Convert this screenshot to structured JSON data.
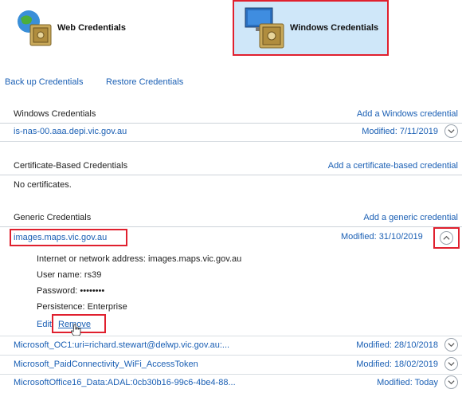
{
  "tiles": {
    "web": {
      "label": "Web Credentials"
    },
    "windows": {
      "label": "Windows Credentials"
    }
  },
  "toolbar": {
    "backup": "Back up Credentials",
    "restore": "Restore Credentials"
  },
  "windows_section": {
    "title": "Windows Credentials",
    "action": "Add a Windows credential",
    "items": [
      {
        "name": "is-nas-00.aaa.depi.vic.gov.au",
        "modified": "Modified:  7/11/2019"
      }
    ]
  },
  "cert_section": {
    "title": "Certificate-Based Credentials",
    "action": "Add a certificate-based credential",
    "empty": "No certificates."
  },
  "generic_section": {
    "title": "Generic Credentials",
    "action": "Add a generic credential",
    "expanded": {
      "name": "images.maps.vic.gov.au",
      "modified": "Modified:  31/10/2019",
      "address_line": "Internet or network address:  images.maps.vic.gov.au",
      "username_line": "User name:  rs39",
      "password_line": "Password:  ••••••••",
      "persistence_line": "Persistence:  Enterprise",
      "edit": "Edit",
      "remove": "Remove"
    },
    "items": [
      {
        "name": "Microsoft_OC1:uri=richard.stewart@delwp.vic.gov.au:...",
        "modified": "Modified:  28/10/2018"
      },
      {
        "name": "Microsoft_PaidConnectivity_WiFi_AccessToken",
        "modified": "Modified:  18/02/2019"
      },
      {
        "name": "MicrosoftOffice16_Data:ADAL:0cb30b16-99c6-4be4-88...",
        "modified": "Modified:  Today"
      }
    ]
  },
  "colors": {
    "link": "#1a5fb4",
    "highlight_border": "#e0202e",
    "selected_tile": "#cfe7f9"
  },
  "icons": [
    "globe-safe-icon",
    "monitor-safe-icon",
    "chevron-up-icon",
    "chevron-down-icon",
    "hand-cursor-icon"
  ]
}
